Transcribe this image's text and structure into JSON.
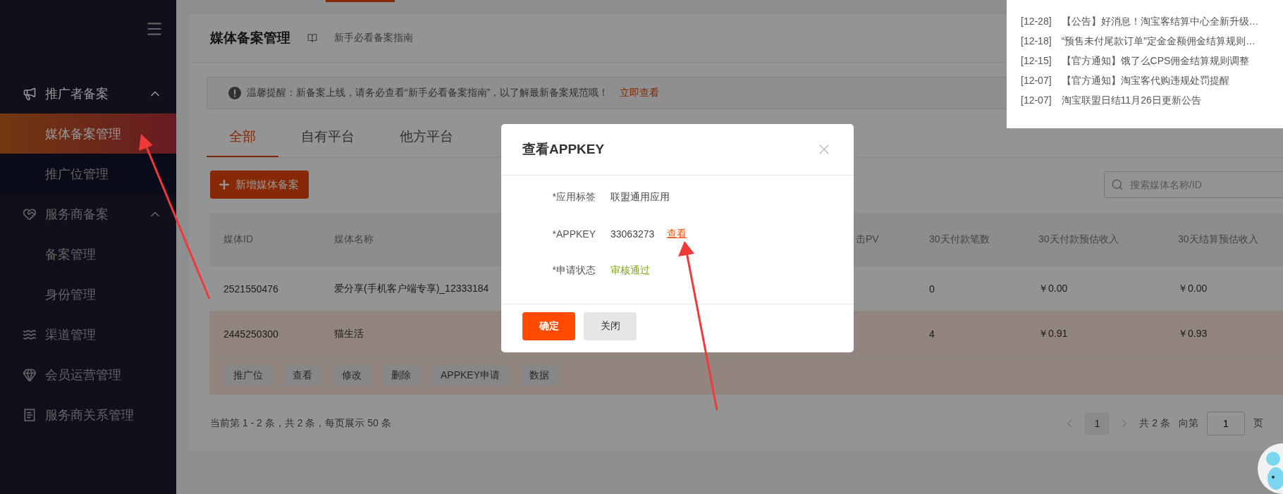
{
  "sidebar": {
    "items": [
      {
        "label": "推广者备案",
        "expanded": true,
        "children": [
          {
            "label": "媒体备案管理",
            "selected": true
          },
          {
            "label": "推广位管理",
            "selected": false
          }
        ]
      },
      {
        "label": "服务商备案",
        "expanded": true,
        "children": [
          {
            "label": "备案管理",
            "selected": false
          },
          {
            "label": "身份管理",
            "selected": false
          }
        ]
      },
      {
        "label": "渠道管理",
        "selected": false
      },
      {
        "label": "会员运营管理",
        "selected": false
      },
      {
        "label": "服务商关系管理",
        "selected": false
      }
    ]
  },
  "page": {
    "title": "媒体备案管理",
    "guide_link": "新手必看备案指南"
  },
  "alert": {
    "text": "温馨提醒：新备案上线，请务必查看“新手必看备案指南”，以了解最新备案规范哦！",
    "link": "立即查看"
  },
  "tabs": [
    {
      "label": "全部",
      "selected": true
    },
    {
      "label": "自有平台",
      "selected": false
    },
    {
      "label": "他方平台",
      "selected": false
    }
  ],
  "add_button": "新增媒体备案",
  "search": {
    "placeholder": "搜索媒体名称/ID"
  },
  "table": {
    "columns": [
      "媒体ID",
      "媒体名称",
      "",
      "击PV",
      "30天付款笔数",
      "30天付款预估收入",
      "30天结算预估收入"
    ],
    "rows": [
      {
        "cells": [
          "2521550476",
          "爱分享(手机客户端专享)_12333184",
          "",
          "",
          "0",
          "￥0.00",
          "￥0.00"
        ],
        "selected": false
      },
      {
        "cells": [
          "2445250300",
          "猫生活",
          "",
          "",
          "4",
          "￥0.91",
          "￥0.93"
        ],
        "selected": true
      }
    ],
    "row_actions": [
      "推广位",
      "查看",
      "修改",
      "删除",
      "APPKEY申请",
      "数据"
    ]
  },
  "footer": {
    "summary": "当前第 1 - 2 条，共 2 条，每页展示 50 条",
    "page": "1",
    "total": "共 2 条",
    "goto_label": "向第",
    "goto_value": "1",
    "goto_unit": "页"
  },
  "notices": [
    {
      "date": "[12-28]",
      "title": "【公告】好消息！淘宝客结算中心全新升级…"
    },
    {
      "date": "[12-18]",
      "title": "“预售未付尾款订单”定金金额佣金结算规则…"
    },
    {
      "date": "[12-15]",
      "title": "【官方通知】饿了么CPS佣金结算规则调整"
    },
    {
      "date": "[12-07]",
      "title": "【官方通知】淘宝客代购违规处罚提醒"
    },
    {
      "date": "[12-07]",
      "title": "淘宝联盟日结11月26日更新公告"
    }
  ],
  "dialog": {
    "title": "查看APPKEY",
    "fields": [
      {
        "kind": "text",
        "label": "*应用标签",
        "value": "联盟通用应用"
      },
      {
        "kind": "secret",
        "label": "*APPKEY",
        "value": "33063273",
        "action": "查看"
      },
      {
        "kind": "status",
        "label": "*申请状态",
        "value": "审核通过"
      }
    ],
    "buttons": [
      {
        "label": "确定",
        "kind": "primary"
      },
      {
        "label": "关闭",
        "kind": "secondary"
      }
    ]
  }
}
